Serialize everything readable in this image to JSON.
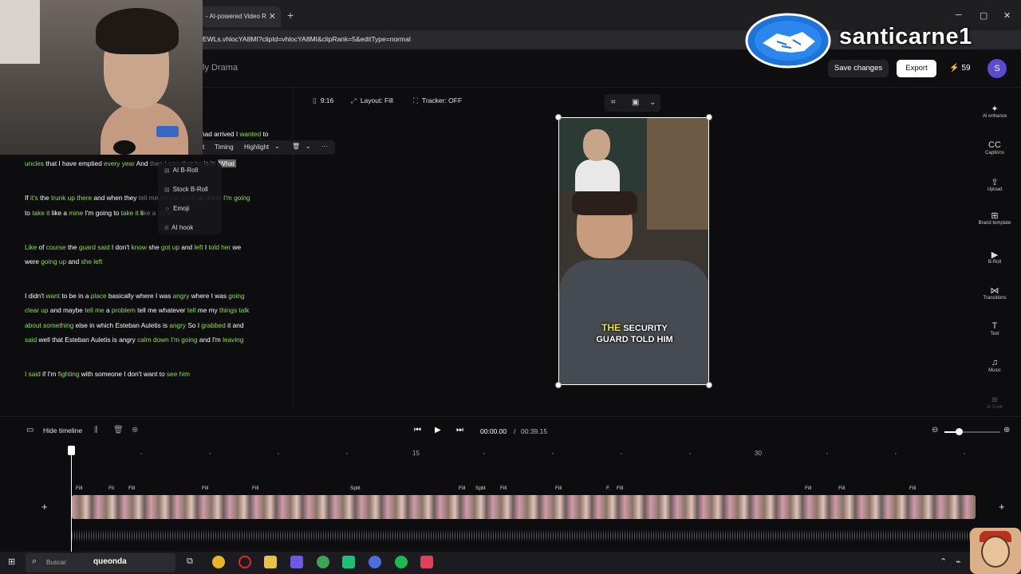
{
  "browser": {
    "tab_title": "- AI-powered Video R",
    "tab_close": "✕",
    "new_tab": "+",
    "url": "EWLs.vhlocYA8MI?clipId=vhlocYA8MI&clipRank=5&editType=normal",
    "win_min": "─",
    "win_max": "▢",
    "win_close": "✕"
  },
  "header": {
    "project_title": "ly Drama",
    "save_label": "Save changes",
    "export_label": "Export",
    "credits": "59",
    "avatar_initial": "S"
  },
  "watermark": {
    "text": "santicarne1"
  },
  "options": {
    "ratio": "9:16",
    "layout": "Layout: Fill",
    "tracker": "Tracker: OFF"
  },
  "word_toolbar": {
    "item_1": "t",
    "timing": "Timing",
    "highlight": "Highlight",
    "more": "···"
  },
  "context_menu": {
    "items": [
      "AI B-Roll",
      "Stock B-Roll",
      "Emoji",
      "AI hook"
    ]
  },
  "transcript": {
    "l1": {
      "a": "had",
      "b": " arrived I ",
      "c": "wanted",
      "d": " to"
    },
    "l2": {
      "a": "uncles",
      "b": " that I have emptied ",
      "c": "every year",
      "d": " And ",
      "e": "then I saw that he",
      "f": " is in ",
      "g": "What"
    },
    "l3": {
      "a": "If ",
      "b": "it's",
      "c": " the ",
      "d": "trunk up there",
      "e": " and when they ",
      "f": "tell me it's the trunk",
      "g": " up there I'm going"
    },
    "l4": {
      "a": "to ",
      "b": "take it",
      "c": " like a ",
      "d": "mine",
      "e": " I'm going to ",
      "f": "take it",
      "g": " li",
      "h": "ke a mine"
    },
    "l5": {
      "a": "Like",
      "b": " of ",
      "c": "course",
      "d": " the ",
      "e": "guard said",
      "f": " I don't ",
      "g": "know",
      "h": " she ",
      "i": "got up",
      "j": " and ",
      "k": "left",
      "l": " I ",
      "m": "told her",
      "n": " we"
    },
    "l6": {
      "a": "were ",
      "b": "going up",
      "c": " and ",
      "d": "she left"
    },
    "l7": {
      "a": "I didn't ",
      "b": "want",
      "c": " to be in a ",
      "d": "place",
      "e": " basically where I was ",
      "f": "angry",
      "g": " where I was ",
      "h": "going"
    },
    "l8": {
      "a": "clear up",
      "b": " and maybe ",
      "c": "tell me",
      "d": " a ",
      "e": "problem",
      "f": " tell me whatever ",
      "g": "tell",
      "h": " me my ",
      "i": "things",
      "j": " ",
      "k": "talk"
    },
    "l9": {
      "a": "about something",
      "b": " else in which Esteban Auletis is ",
      "c": "angry",
      "d": " So I ",
      "e": "grabbed",
      "f": " it and"
    },
    "l10": {
      "a": "said",
      "b": " well that Esteban Auletis is angry ",
      "c": "calm down",
      "d": " ",
      "e": "I'm going",
      "f": " and I'm ",
      "g": "leaving"
    },
    "l11": {
      "a": "I said",
      "b": " if I'm ",
      "c": "fighting",
      "d": " with someone I don't want to ",
      "e": "see him"
    }
  },
  "preview": {
    "caption_1": "THE",
    "caption_2": "SECURITY",
    "caption_3": "GUARD TOLD HIM"
  },
  "right_toolbar": [
    {
      "icon": "✦",
      "label": "AI enhance"
    },
    {
      "icon": "CC",
      "label": "Captions"
    },
    {
      "icon": "⇪",
      "label": "Upload"
    },
    {
      "icon": "⊞",
      "label": "Brand template"
    },
    {
      "icon": "▶",
      "label": "B-Roll"
    },
    {
      "icon": "⋈",
      "label": "Transitions"
    },
    {
      "icon": "T",
      "label": "Text"
    },
    {
      "icon": "♫",
      "label": "Music"
    },
    {
      "icon": "≋",
      "label": "AI hook"
    }
  ],
  "timeline": {
    "hide_label": "Hide timeline",
    "time_now": "00:00.00",
    "time_sep": "/",
    "time_total": "00:39.15",
    "ruler_15": "15",
    "ruler_30": "30",
    "zoom_level": 0.25,
    "clip_labels": [
      "Fill",
      "Fit",
      "Fill",
      "Fill",
      "Fill",
      "Split",
      "Fill",
      "Split",
      "Fill",
      "Fill",
      "F.",
      "Fill",
      "Fill",
      "Fill",
      "Fill"
    ],
    "add": "+"
  },
  "taskbar": {
    "search_placeholder": "Buscar",
    "search_text": "queonda"
  },
  "colors": {
    "word_green": "#8ae04a",
    "word_yellow": "#e6e65a",
    "caption_yellow": "#f2e33a",
    "credits_bolt": "#f5c542",
    "avatar": "#5b4bd0"
  }
}
